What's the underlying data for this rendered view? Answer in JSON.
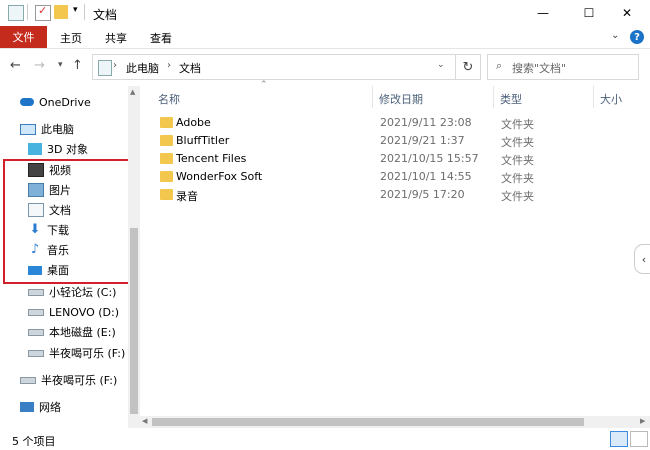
{
  "window": {
    "title": "文档"
  },
  "ribbon": {
    "tabs": [
      "文件",
      "主页",
      "共享",
      "查看"
    ],
    "help": "?",
    "collapse": "⌄"
  },
  "window_buttons": {
    "minimize": "—",
    "maximize": "☐",
    "close": "✕"
  },
  "address": {
    "crumbs": [
      "此电脑",
      "文档"
    ],
    "sep": "›"
  },
  "search": {
    "placeholder": "搜索\"文档\""
  },
  "nav": {
    "items": [
      {
        "label": "OneDrive",
        "icon": "cloud-icon"
      },
      {
        "label": "此电脑",
        "icon": "computer-icon"
      },
      {
        "label": "3D 对象",
        "icon": "cube-icon"
      },
      {
        "label": "视频",
        "icon": "video-icon"
      },
      {
        "label": "图片",
        "icon": "image-icon"
      },
      {
        "label": "文档",
        "icon": "document-icon"
      },
      {
        "label": "下载",
        "icon": "download-icon"
      },
      {
        "label": "音乐",
        "icon": "music-icon"
      },
      {
        "label": "桌面",
        "icon": "desktop-icon"
      },
      {
        "label": "小轻论坛 (C:)",
        "icon": "drive-icon"
      },
      {
        "label": "LENOVO (D:)",
        "icon": "drive-icon"
      },
      {
        "label": "本地磁盘 (E:)",
        "icon": "drive-icon"
      },
      {
        "label": "半夜喝可乐 (F:)",
        "icon": "drive-icon"
      },
      {
        "label": "半夜喝可乐 (F:)",
        "icon": "drive-icon"
      },
      {
        "label": "网络",
        "icon": "network-icon"
      }
    ]
  },
  "columns": [
    "名称",
    "修改日期",
    "类型",
    "大小"
  ],
  "files": [
    {
      "name": "Adobe",
      "date": "2021/9/11 23:08",
      "type": "文件夹"
    },
    {
      "name": "BluffTitler",
      "date": "2021/9/21 1:37",
      "type": "文件夹"
    },
    {
      "name": "Tencent Files",
      "date": "2021/10/15 15:57",
      "type": "文件夹"
    },
    {
      "name": "WonderFox Soft",
      "date": "2021/10/1 14:55",
      "type": "文件夹"
    },
    {
      "name": "录音",
      "date": "2021/9/5 17:20",
      "type": "文件夹"
    }
  ],
  "status": {
    "count": "5 个项目"
  },
  "colors": {
    "accent_file_tab": "#c42b1c",
    "folder": "#f3c74e",
    "highlight": "#d0202a"
  }
}
